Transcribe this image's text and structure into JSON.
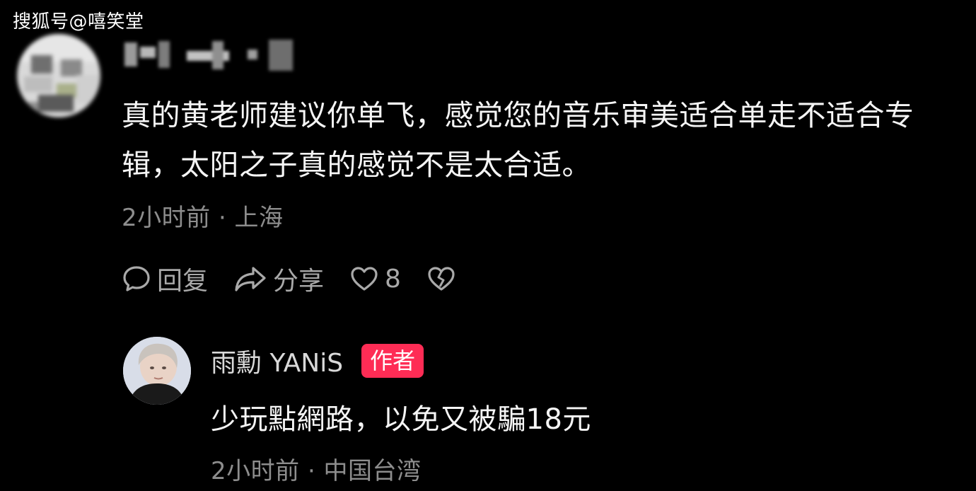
{
  "watermark": "搜狐号@嘻笑堂",
  "comment": {
    "username_hidden": true,
    "text": "真的黄老师建议你单飞，感觉您的音乐审美适合单走不适合专辑，太阳之子真的感觉不是太合适。",
    "meta": "2小时前 · 上海",
    "actions": {
      "reply_icon": "comment-bubble-icon",
      "reply_label": "回复",
      "share_icon": "share-arrow-icon",
      "share_label": "分享",
      "like_icon": "heart-icon",
      "like_count": "8",
      "dislike_icon": "broken-heart-icon"
    }
  },
  "reply": {
    "username": "雨勳 YANiS",
    "badge": "作者",
    "badge_color": "#fe2c55",
    "text": "少玩點網路，以免又被騙18元",
    "meta": "2小时前 · 中国台湾"
  }
}
